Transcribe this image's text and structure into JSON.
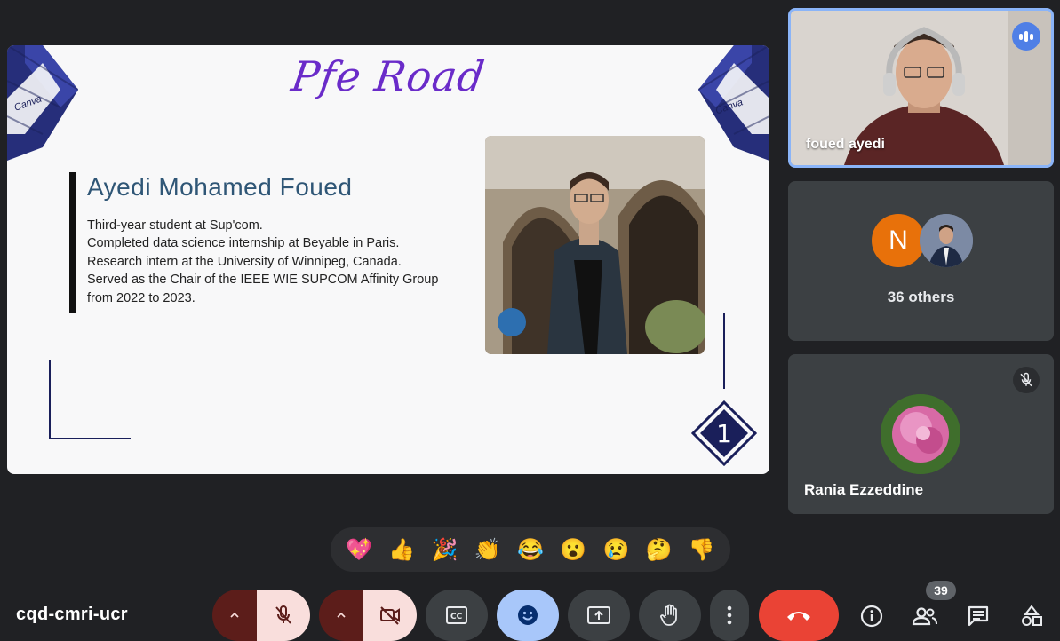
{
  "slide": {
    "title": "Pfe Road",
    "name": "Ayedi Mohamed Foued",
    "bio_lines": [
      "Third-year student at Sup'com.",
      "Completed data science internship at Beyable in Paris.",
      "Research intern at the University of Winnipeg, Canada.",
      "Served as the Chair of the IEEE WIE SUPCOM Affinity Group",
      "from 2022 to 2023."
    ],
    "page_number": "1",
    "corner_watermark": "Canva"
  },
  "participants": {
    "speaker": {
      "name": "foued ayedi",
      "status_icon": "speaking-icon"
    },
    "others": {
      "avatar_initial": "N",
      "label": "36 others"
    },
    "rania": {
      "name": "Rania Ezzeddine",
      "status_icon": "mic-off-icon"
    }
  },
  "reactions": [
    "💖",
    "👍",
    "🎉",
    "👏",
    "😂",
    "😮",
    "😢",
    "🤔",
    "👎"
  ],
  "meeting": {
    "code": "cqd-cmri-ucr"
  },
  "controls": {
    "participants_count": "39",
    "icons": [
      "chevron-up-icon",
      "mic-off-icon",
      "chevron-up-icon",
      "camera-off-icon",
      "captions-icon",
      "emoji-icon",
      "present-icon",
      "raise-hand-icon",
      "more-options-icon",
      "hangup-icon",
      "info-icon",
      "people-icon",
      "chat-icon",
      "activities-icon"
    ]
  },
  "colors": {
    "background": "#202124",
    "accent": "#8ab4f8",
    "hangup": "#ea4335",
    "avatar_n": "#e8710a"
  }
}
